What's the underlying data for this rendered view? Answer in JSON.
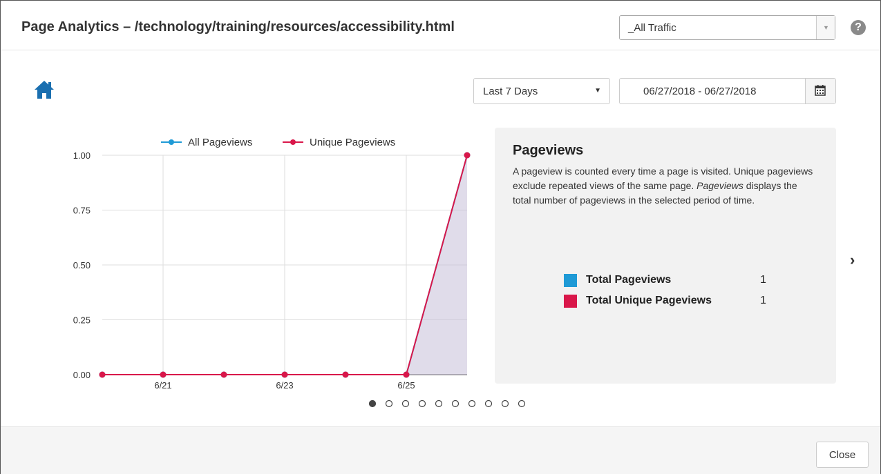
{
  "header": {
    "title": "Page Analytics – /technology/training/resources/accessibility.html",
    "traffic_select": "_All Traffic",
    "help_icon": "question-circle-icon"
  },
  "toolbar": {
    "home_icon": "home-icon",
    "range_select": "Last 7 Days",
    "date_range": "06/27/2018 - 06/27/2018",
    "calendar_icon": "calendar-icon"
  },
  "chart_data": {
    "type": "line",
    "x": [
      "6/20",
      "6/21",
      "6/22",
      "6/23",
      "6/24",
      "6/25",
      "6/26"
    ],
    "x_tick_labels": [
      "6/21",
      "6/23",
      "6/25"
    ],
    "y_tick_labels": [
      "1.00",
      "0.75",
      "0.50",
      "0.25",
      "0.00"
    ],
    "ylim": [
      0,
      1
    ],
    "series": [
      {
        "name": "All Pageviews",
        "values": [
          0,
          0,
          0,
          0,
          0,
          0,
          1
        ],
        "color": "#1f9ad6"
      },
      {
        "name": "Unique Pageviews",
        "values": [
          0,
          0,
          0,
          0,
          0,
          0,
          1
        ],
        "color": "#d9174a"
      }
    ],
    "grid": true,
    "legend": "top"
  },
  "panel": {
    "title": "Pageviews",
    "desc_1": "A pageview is counted every time a page is visited. Unique pageviews exclude repeated views of the same page. ",
    "desc_em": "Pageviews",
    "desc_2": " displays the total number of pageviews in the selected period of time.",
    "totals": [
      {
        "label": "Total Pageviews",
        "value": "1",
        "color": "#1f9ad6"
      },
      {
        "label": "Total Unique Pageviews",
        "value": "1",
        "color": "#d9174a"
      }
    ]
  },
  "carousel": {
    "count": 10,
    "active": 0,
    "next_icon": "chevron-right-icon"
  },
  "footer": {
    "close_label": "Close"
  }
}
